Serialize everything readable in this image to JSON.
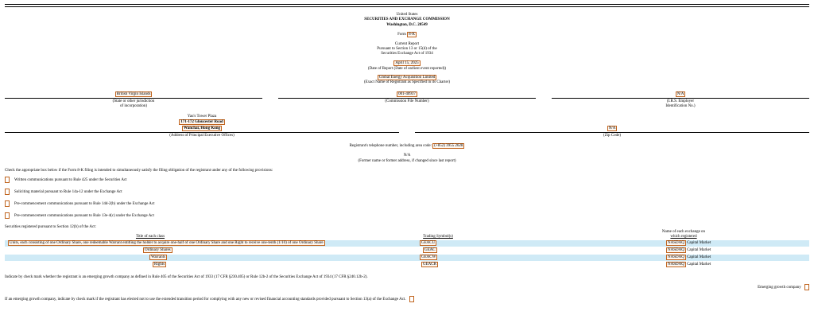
{
  "header": {
    "line1": "United States",
    "line2": "SECURITIES AND EXCHANGE COMMISSION",
    "line3": "Washington, D.C. 20549",
    "form_prefix": "Form",
    "form_type": "8-K",
    "report_title": "Current Report",
    "pursuant1": "Pursuant to Section 13 or 15(d) of the",
    "pursuant2": "Securities Exchange Act of 1934",
    "report_date": "April 15, 2025",
    "report_date_caption": "(Date of Report (Date of earliest event reported))",
    "registrant_name": "Global Energy Acquisition Limited",
    "registrant_caption": "(Exact Name of Registrant as Specified in its Charter)"
  },
  "registrant_info": {
    "jurisdiction": "British Virgin Islands",
    "jurisdiction_caption_1": "(State or other jurisdiction",
    "jurisdiction_caption_2": "of incorporation)",
    "commission_file": "001-40937",
    "commission_caption": "(Commission File Number)",
    "ein": "N/A",
    "ein_caption_1": "(I.R.S. Employer",
    "ein_caption_2": "Identification No.)"
  },
  "address": {
    "label": "Yau's Tower Plaza",
    "street": "171-172 Gloucester Road",
    "city": "Wanchai, Hong Kong",
    "caption": "(Address of Principal Executive Offices)",
    "zip": "N/A",
    "zip_caption": "(Zip Code)"
  },
  "phone": {
    "label": "Registrant's telephone number, including area code:",
    "number": "(+852) 3955 2628"
  },
  "former": {
    "value": "N/A",
    "caption": "(Former name or former address, if changed since last report)"
  },
  "instructions": "Check the appropriate box below if the Form 8-K filing is intended to simultaneously satisfy the filing obligation of the registrant under any of the following provisions:",
  "checkboxes": [
    "Written communications pursuant to Rule 425 under the Securities Act",
    "Soliciting material pursuant to Rule 14a-12 under the Exchange Act",
    "Pre-commencement communications pursuant to Rule 14d-2(b) under the Exchange Act",
    "Pre-commencement communications pursuant to Rule 13e-4(c) under the Exchange Act"
  ],
  "securities": {
    "intro": "Securities registered pursuant to Section 12(b) of the Act:",
    "headers": {
      "title": "Title of each class",
      "symbol": "Trading Symbol(s)",
      "exchange_1": "Name of each exchange on",
      "exchange_2": "which registered"
    },
    "rows": [
      {
        "title": "Units, each consisting of one Ordinary Share, one redeemable Warrant entitling the holder to acquire one-half of one Ordinary Share and one Right to receive one-tenth (1/10) of one Ordinary Share",
        "symbol": "GEACU",
        "exchange": "NASDAQ",
        "market": "Capital Market"
      },
      {
        "title": "Ordinary Shares",
        "symbol": "GEAC",
        "exchange": "NASDAQ",
        "market": "Capital Market"
      },
      {
        "title": "Warrants",
        "symbol": "GEACW",
        "exchange": "NASDAQ",
        "market": "Capital Market"
      },
      {
        "title": "Rights",
        "symbol": "GEACR",
        "exchange": "NASDAQ",
        "market": "Capital Market"
      }
    ]
  },
  "emerging": {
    "text": "Indicate by check mark whether the registrant is an emerging growth company as defined in Rule 405 of the Securities Act of 1933 (17 CFR §230.405) or Rule 12b-2 of the Securities Exchange Act of 1934 (17 CFR §240.12b-2).",
    "egc_label": "Emerging growth company",
    "transition_text": "If an emerging growth company, indicate by check mark if the registrant has elected not to use the extended transition period for complying with any new or revised financial accounting standards provided pursuant to Section 13(a) of the Exchange Act."
  }
}
